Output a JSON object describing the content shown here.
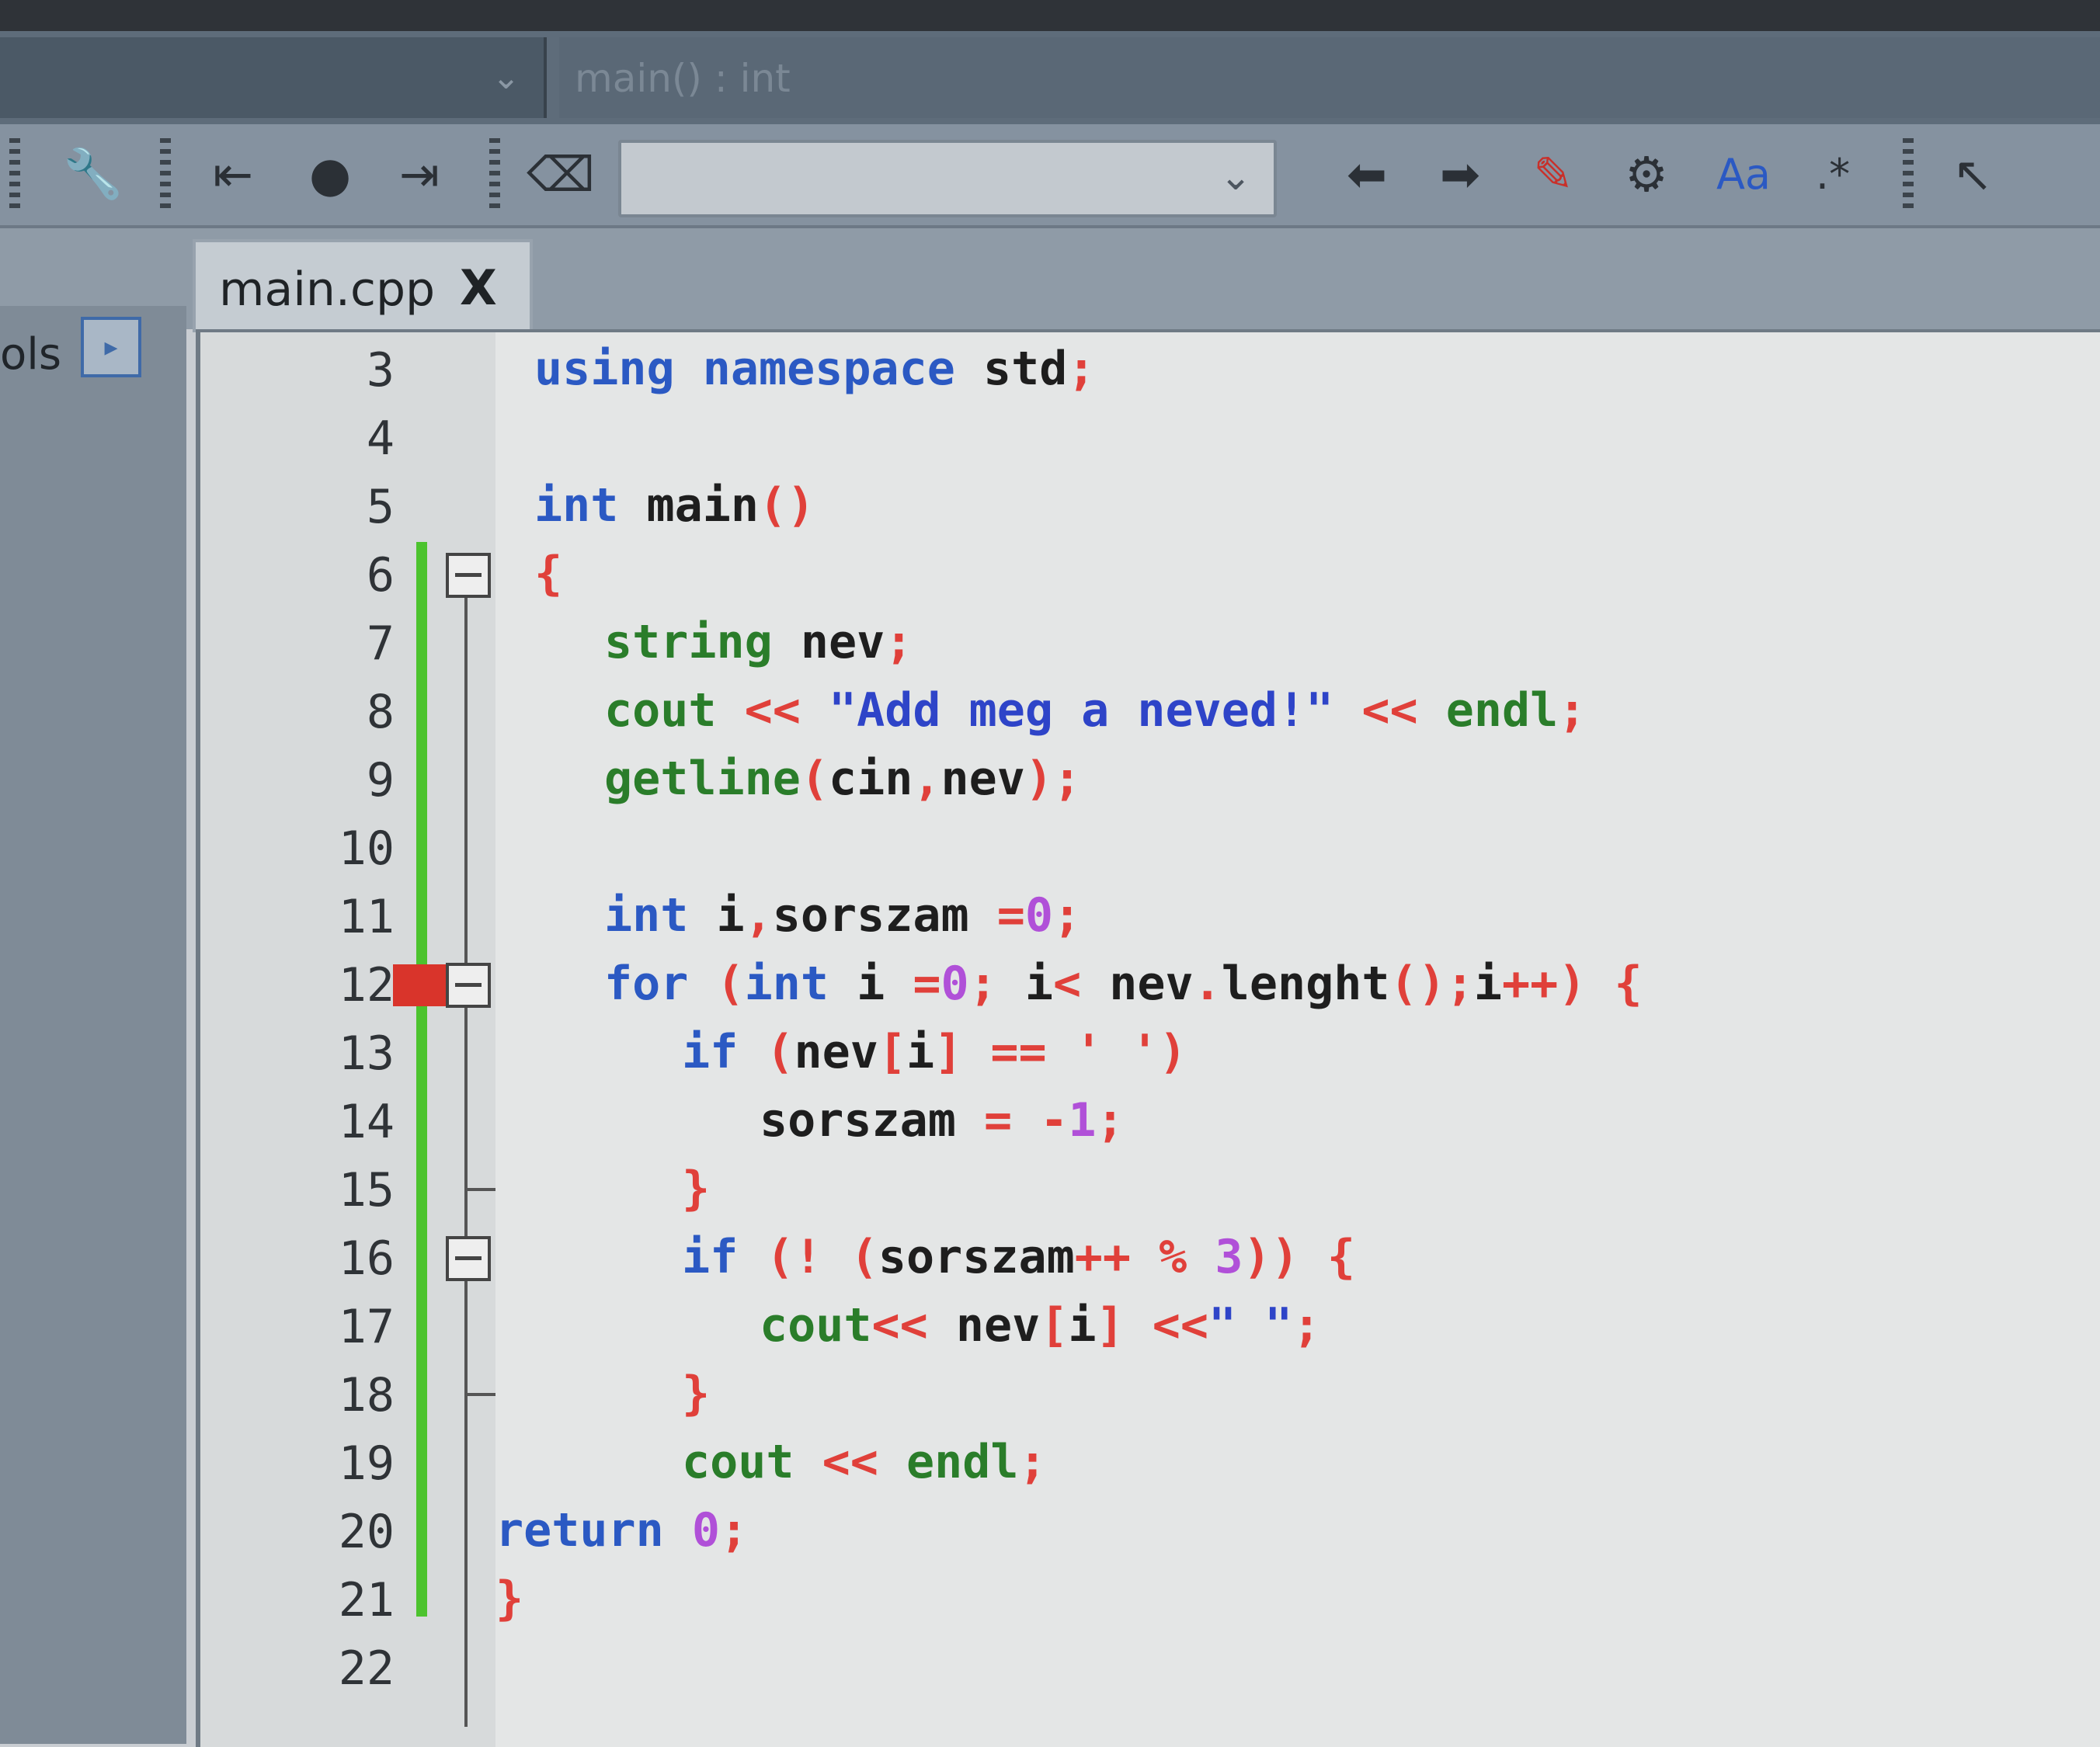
{
  "scope": {
    "function_label": "main() : int"
  },
  "toolbar": {
    "items": [
      "wrench-icon",
      "jump-back-icon",
      "bookmark-dot-icon",
      "jump-forward-icon",
      "clear-icon",
      "back-arrow-icon",
      "forward-arrow-icon",
      "highlight-icon",
      "build-icon",
      "match-case-icon",
      "regex-icon",
      "select-cursor-icon"
    ],
    "search_value": ""
  },
  "tab": {
    "name": "main.cpp",
    "close": "X"
  },
  "left_panel": {
    "label": "ols",
    "button": "▸"
  },
  "editor": {
    "lines": [
      {
        "n": "3",
        "tokens": [
          [
            "kw",
            "using"
          ],
          [
            "id",
            " "
          ],
          [
            "kw",
            "namespace"
          ],
          [
            "id",
            " std"
          ],
          [
            "op",
            ";"
          ]
        ]
      },
      {
        "n": "4",
        "tokens": []
      },
      {
        "n": "5",
        "tokens": [
          [
            "ty",
            "int"
          ],
          [
            "id",
            " main"
          ],
          [
            "op",
            "()"
          ]
        ]
      },
      {
        "n": "6",
        "tokens": [
          [
            "op",
            "{"
          ]
        ]
      },
      {
        "n": "7",
        "tokens": [
          [
            "fn",
            "string"
          ],
          [
            "id",
            " nev"
          ],
          [
            "op",
            ";"
          ]
        ]
      },
      {
        "n": "8",
        "tokens": [
          [
            "fn",
            "cout"
          ],
          [
            "op",
            " << "
          ],
          [
            "str",
            "\"Add meg a neved!\""
          ],
          [
            "op",
            " << "
          ],
          [
            "fn",
            "endl"
          ],
          [
            "op",
            ";"
          ]
        ]
      },
      {
        "n": "9",
        "tokens": [
          [
            "fn",
            "getline"
          ],
          [
            "op",
            "("
          ],
          [
            "id",
            "cin"
          ],
          [
            "op",
            ","
          ],
          [
            "id",
            "nev"
          ],
          [
            "op",
            ");"
          ]
        ]
      },
      {
        "n": "10",
        "tokens": []
      },
      {
        "n": "11",
        "tokens": [
          [
            "ty",
            "int"
          ],
          [
            "id",
            " i"
          ],
          [
            "op",
            ","
          ],
          [
            "id",
            "sorszam "
          ],
          [
            "op",
            "="
          ],
          [
            "num",
            "0"
          ],
          [
            "op",
            ";"
          ]
        ]
      },
      {
        "n": "12",
        "tokens": [
          [
            "kw",
            "for"
          ],
          [
            "op",
            " ("
          ],
          [
            "ty",
            "int"
          ],
          [
            "id",
            " i "
          ],
          [
            "op",
            "="
          ],
          [
            "num",
            "0"
          ],
          [
            "op",
            "; "
          ],
          [
            "id",
            "i"
          ],
          [
            "op",
            "< "
          ],
          [
            "id",
            "nev"
          ],
          [
            "op",
            "."
          ],
          [
            "id",
            "lenght"
          ],
          [
            "op",
            "();"
          ],
          [
            "id",
            "i"
          ],
          [
            "op",
            "++) {"
          ]
        ]
      },
      {
        "n": "13",
        "tokens": [
          [
            "kw",
            "if"
          ],
          [
            "op",
            " ("
          ],
          [
            "id",
            "nev"
          ],
          [
            "op",
            "["
          ],
          [
            "id",
            "i"
          ],
          [
            "op",
            "] == ' ')"
          ]
        ]
      },
      {
        "n": "14",
        "tokens": [
          [
            "id",
            "sorszam "
          ],
          [
            "op",
            "= -"
          ],
          [
            "num",
            "1"
          ],
          [
            "op",
            ";"
          ]
        ]
      },
      {
        "n": "15",
        "tokens": [
          [
            "op",
            "}"
          ]
        ]
      },
      {
        "n": "16",
        "tokens": [
          [
            "kw",
            "if"
          ],
          [
            "op",
            " (! ("
          ],
          [
            "id",
            "sorszam"
          ],
          [
            "op",
            "++ % "
          ],
          [
            "num",
            "3"
          ],
          [
            "op",
            ")) {"
          ]
        ]
      },
      {
        "n": "17",
        "tokens": [
          [
            "fn",
            "cout"
          ],
          [
            "op",
            "<< "
          ],
          [
            "id",
            "nev"
          ],
          [
            "op",
            "["
          ],
          [
            "id",
            "i"
          ],
          [
            "op",
            "] <<"
          ],
          [
            "str",
            "\" \""
          ],
          [
            "op",
            ";"
          ]
        ]
      },
      {
        "n": "18",
        "tokens": [
          [
            "op",
            "}"
          ]
        ]
      },
      {
        "n": "19",
        "tokens": [
          [
            "fn",
            "cout"
          ],
          [
            "op",
            " << "
          ],
          [
            "fn",
            "endl"
          ],
          [
            "op",
            ";"
          ]
        ]
      },
      {
        "n": "20",
        "tokens": [
          [
            "kw",
            "return"
          ],
          [
            "id",
            " "
          ],
          [
            "num",
            "0"
          ],
          [
            "op",
            ";"
          ]
        ]
      },
      {
        "n": "21",
        "tokens": [
          [
            "op",
            "}"
          ]
        ]
      },
      {
        "n": "22",
        "tokens": []
      }
    ]
  }
}
